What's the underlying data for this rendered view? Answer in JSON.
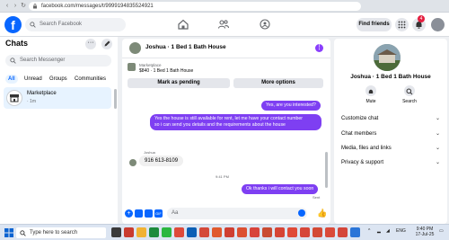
{
  "browser": {
    "url": "facebook.com/messages/t/9999194835524921"
  },
  "header": {
    "logo": "f",
    "search_placeholder": "Search Facebook",
    "find_friends": "Find friends",
    "notification_count": "4"
  },
  "sidebar": {
    "title": "Chats",
    "search_placeholder": "Search Messenger",
    "filters": [
      "All",
      "Unread",
      "Groups",
      "Communities"
    ],
    "conversation": {
      "name": "Marketplace",
      "time": "· 1m"
    }
  },
  "chat": {
    "title": "Joshua · 1 Bed 1 Bath House",
    "listing_label": "Marketplace",
    "listing_price": "$840 · 1 Bed 1 Bath House",
    "mark_pending": "Mark as pending",
    "more_options": "More options",
    "messages": {
      "out1": "Yes, are you interested?",
      "out2_line1": "Yes the house is still available for rent, let me have your contact number",
      "out2_line2": "so i can send you details and the requirements about the house",
      "in_sender": "Joshua",
      "in1": "916 613-8109",
      "time": "9:41 PM",
      "out3": "Ok thanks i will contact you soon",
      "status": "Sent"
    },
    "composer_placeholder": "Aa"
  },
  "right_panel": {
    "name": "Joshua · 1 Bed 1 Bath House",
    "mute_label": "Mute",
    "search_label": "Search",
    "rows": [
      "Customize chat",
      "Chat members",
      "Media, files and links",
      "Privacy & support"
    ]
  },
  "taskbar": {
    "search_placeholder": "Type here to search",
    "lang": "ENG",
    "time": "9:40 PM",
    "date": "17-Jul-25"
  },
  "colors": {
    "brand": "#0866ff",
    "bubble_out": "#7e3ff2"
  }
}
